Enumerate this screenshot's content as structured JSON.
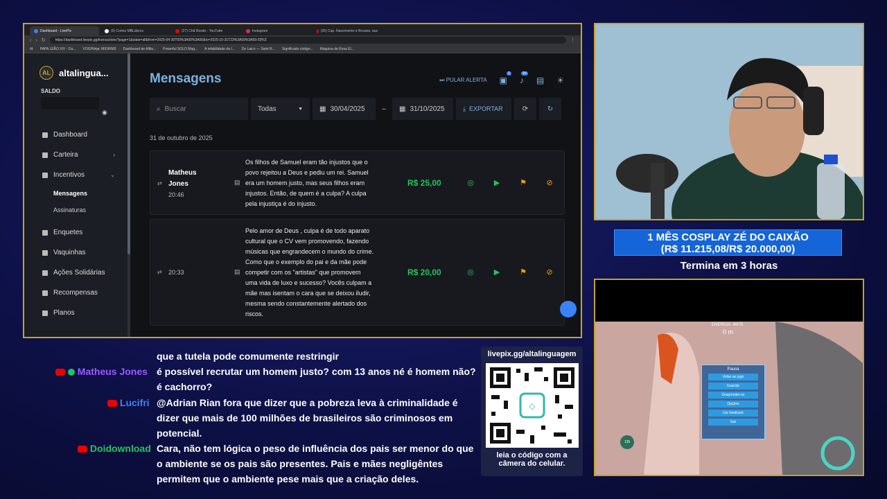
{
  "browser": {
    "tabs": [
      {
        "label": "Dashboard - LivePix",
        "active": true
      },
      {
        "label": "(6) Cortes MBLáticos"
      },
      {
        "label": "(27) Chã Rosdo - YouTube"
      },
      {
        "label": "Instagram"
      },
      {
        "label": "(26) Cap. Nascimento e Roxane, aus"
      }
    ],
    "url": "https://dashboard.livepix.gg/transactions?page=1&state=all&from=2025-04-30T00%3A00%3A00&to=2025-10-31T23%3A59%3A59-03%3",
    "bookmarks": [
      "IA",
      "PAPA LEÃO XIV - Go...",
      "VOG/Ninja: MIORIM3",
      "Dashboard de Afilia...",
      "Powerful SOLO Mag...",
      "A infabilidade da I...",
      "De Laico — Saint R...",
      "Significado código...",
      "Máquina de Rosa El..."
    ]
  },
  "app": {
    "logo_badge": "AL",
    "logo_text": "altalingua...",
    "saldo_label": "SALDO",
    "menu": [
      {
        "label": "Dashboard"
      },
      {
        "label": "Carteira",
        "chev": "›"
      },
      {
        "label": "Incentivos",
        "chev": "⌄"
      },
      {
        "label": "Enquetes"
      },
      {
        "label": "Vaquinhas"
      },
      {
        "label": "Ações Solidárias"
      },
      {
        "label": "Recompensas"
      },
      {
        "label": "Planos"
      }
    ],
    "submenu": [
      {
        "label": "Mensagens"
      },
      {
        "label": "Assinaturas"
      }
    ],
    "page_title": "Mensagens",
    "pular_alerta": "PULAR ALERTA",
    "badge1": "1",
    "badge2": "9+",
    "search_placeholder": "Buscar",
    "filter_select": "Todas",
    "date_from": "30/04/2025",
    "date_sep": "–",
    "date_to": "31/10/2025",
    "exportar": "EXPORTAR",
    "date_header": "31 de outubro de 2025",
    "messages": [
      {
        "name_line1": "Matheus",
        "name_line2": "Jones",
        "time": "20:46",
        "lines": [
          "Os filhos de Samuel eram tão injustos que o",
          "povo rejeitou a Deus e pediu um rei. Samuel",
          "era um homem justo, mas seus filhos eram",
          "injustos. Então, de quem é a culpa? A culpa",
          "pela injustiça é do injusto."
        ],
        "amount": "R$ 25,00"
      },
      {
        "time": "20:33",
        "lines": [
          "Pelo amor de Deus , culpa é de todo aparato",
          "cultural que o CV vem promovendo, fazendo",
          "músicas que engrandecem o mundo do crime.",
          "Como que o exemplo do pai e da mãe pode",
          "competir com os \"artistas\" que promovem",
          "uma vida de luxo e sucesso? Vocês culpam a",
          "mãe mas isentam o cara que se deixou iludir,",
          "mesma sendo constantemente alertado dos",
          "riscos."
        ],
        "amount": "R$ 20,00"
      }
    ]
  },
  "goal": {
    "line1": "1 MÊS COSPLAY ZÉ DO CAIXÃO",
    "line2": "(R$ 11.215,08/R$ 20.000,00)",
    "sub": "Termina em 3 horas"
  },
  "game": {
    "energy": "ENERGIA: 48/75",
    "depth": "0 m",
    "pause_title": "Pausa",
    "pause_buttons": [
      "Voltar ao jogo",
      "Guardar",
      "Desprender-se",
      "Opções",
      "Dar feedback",
      "Sair"
    ],
    "oxygen": "135"
  },
  "qr": {
    "url": "livepix.gg/altalinguagem",
    "caption1": "leia o código com a",
    "caption2": "câmera do celular."
  },
  "chat": [
    {
      "user": "",
      "text": "que a tutela pode comumente restringir",
      "color": "#ffffff"
    },
    {
      "user": "Matheus Jones",
      "text": "é possível recrutar um homem justo? com 13 anos né é homem não?",
      "color": "#9b59ff"
    },
    {
      "user": "",
      "text": "é cachorro?",
      "color": "#ffffff"
    },
    {
      "user": "Lucifri",
      "text": "@Adrian Rian fora que dizer que a pobreza leva à criminalidade é",
      "color": "#3b82f6"
    },
    {
      "user": "",
      "text": "dizer que mais de 100 milhões de brasileiros são criminosos em",
      "color": "#ffffff"
    },
    {
      "user": "",
      "text": "potencial.",
      "color": "#ffffff"
    },
    {
      "user": "Doidownload",
      "text": "Cara, não tem lógica o peso de influência dos pais ser menor do que",
      "color": "#22c55e"
    },
    {
      "user": "",
      "text": "o ambiente se os pais são presentes. Pais e mães negligêntes",
      "color": "#ffffff"
    },
    {
      "user": "",
      "text": "permitem que o ambiente pese mais que a criação deles.",
      "color": "#ffffff"
    }
  ],
  "colors": {
    "frame": "#c9a227",
    "amount": "#22c55e",
    "accent": "#7fb3e0"
  }
}
